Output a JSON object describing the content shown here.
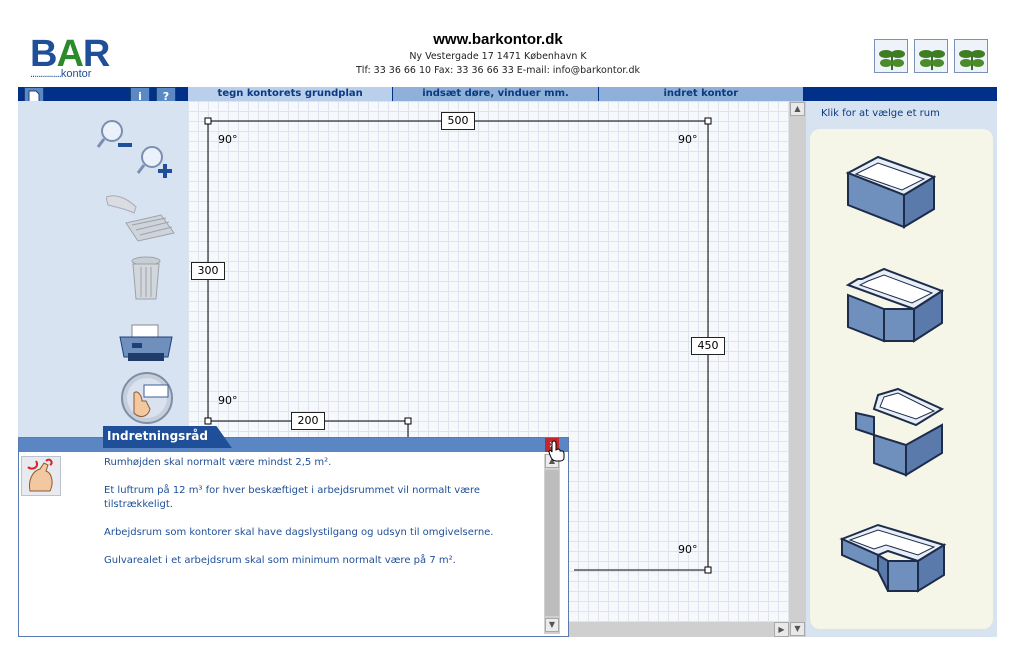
{
  "logo": {
    "letters_b": "B",
    "letters_a": "A",
    "letters_r": "R",
    "dots": "...............",
    "sub": "kontor"
  },
  "header": {
    "site": "www.barkontor.dk",
    "address": "Ny Vestergade 17    1471  København K",
    "contact": "Tlf: 33 36 66 10    Fax: 33 36 66 33    E-mail: info@barkontor.dk"
  },
  "nav": {
    "new_icon": "document-icon",
    "info_label": "i",
    "help_label": "?",
    "tabs": [
      {
        "label": "tegn kontorets grundplan",
        "active": true
      },
      {
        "label": "indsæt døre, vinduer mm.",
        "active": false
      },
      {
        "label": "indret kontor",
        "active": false
      }
    ]
  },
  "toolbar": {
    "tools": [
      "zoom-out-icon",
      "zoom-in-icon",
      "grid-hand-icon",
      "trash-icon",
      "print-icon",
      "select-hand-icon"
    ]
  },
  "floorplan": {
    "dims": {
      "top": "500",
      "left": "300",
      "right": "450",
      "bottom_inner": "200"
    },
    "angles": {
      "top_left": "90°",
      "top_right": "90°",
      "mid_left": "90°",
      "bottom_right": "90°"
    }
  },
  "right_panel": {
    "title": "Klik for at vælge et rum",
    "rooms": [
      "rectangle-room",
      "notched-corner-room",
      "step-room",
      "l-shaped-room"
    ]
  },
  "dialog": {
    "title": "Indretningsråd",
    "close": "x",
    "paragraphs": [
      "Rumhøjden skal normalt være mindst 2,5 m².",
      "Et luftrum på 12 m³ for hver beskæftiget i arbejdsrummet vil normalt være tilstrækkeligt.",
      "Arbejdsrum som kontorer skal have dagslystilgang og udsyn til omgivelserne.",
      "Gulvarealet i et arbejdsrum skal som minimum normalt være på 7 m²."
    ]
  },
  "colors": {
    "brand_blue": "#003087",
    "tab_blue": "#8fb0d8",
    "panel_blue": "#d7e3f1",
    "logo_green": "#2b8a2b"
  }
}
